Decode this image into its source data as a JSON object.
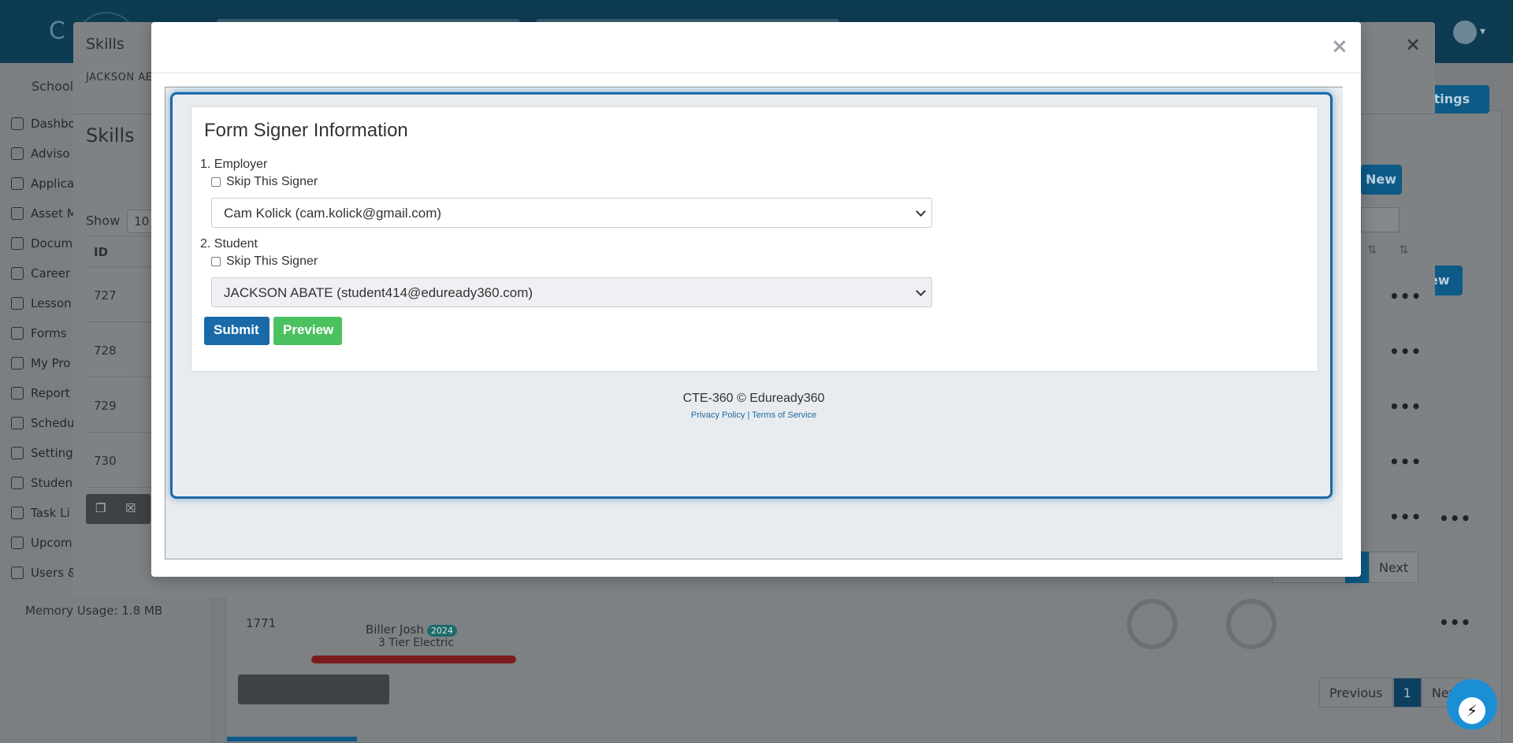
{
  "background": {
    "school_label": "School",
    "nav_items": [
      "Dashbo",
      "Adviso",
      "Applica",
      "Asset M",
      "Docum",
      "Career",
      "Lesson",
      "Forms",
      "My Pro",
      "Report",
      "Schedu",
      "Setting",
      "Studen",
      "Task Li",
      "Upcom",
      "Users &"
    ],
    "memory_usage": "Memory Usage: 1.8 MB",
    "settings_button": "ttings",
    "new_button_bg": "ew",
    "row_name": "Biller Josh",
    "row_year": "2024",
    "row_sub": "3 Tier Electric",
    "row_id": "1771",
    "pager_prev": "Previous",
    "pager_page": "1",
    "pager_next": "Nex"
  },
  "outer_modal": {
    "title": "Skills",
    "subtitle": "JACKSON AE",
    "heading": "Skills",
    "show_label": "Show",
    "show_value": "10",
    "id_header": "ID",
    "rows": [
      "727",
      "728",
      "729",
      "730"
    ],
    "new_button": "New",
    "next_button": "Next",
    "close_glyph": "×"
  },
  "inner_modal": {
    "close_glyph": "×",
    "form": {
      "title": "Form Signer Information",
      "signers": [
        {
          "label": "1. Employer",
          "skip_label": "Skip This Signer",
          "selected": "Cam Kolick (cam.kolick@gmail.com)"
        },
        {
          "label": "2. Student",
          "skip_label": "Skip This Signer",
          "selected": "JACKSON ABATE (student414@eduready360.com)"
        }
      ],
      "submit_label": "Submit",
      "preview_label": "Preview"
    },
    "footer": {
      "copyright": "CTE-360 © Eduready360",
      "privacy": "Privacy Policy",
      "separator": "|",
      "terms": "Terms of Service"
    }
  },
  "colors": {
    "primary": "#1a6aa8",
    "success": "#4cc15f",
    "topbar": "#0d3b52"
  }
}
